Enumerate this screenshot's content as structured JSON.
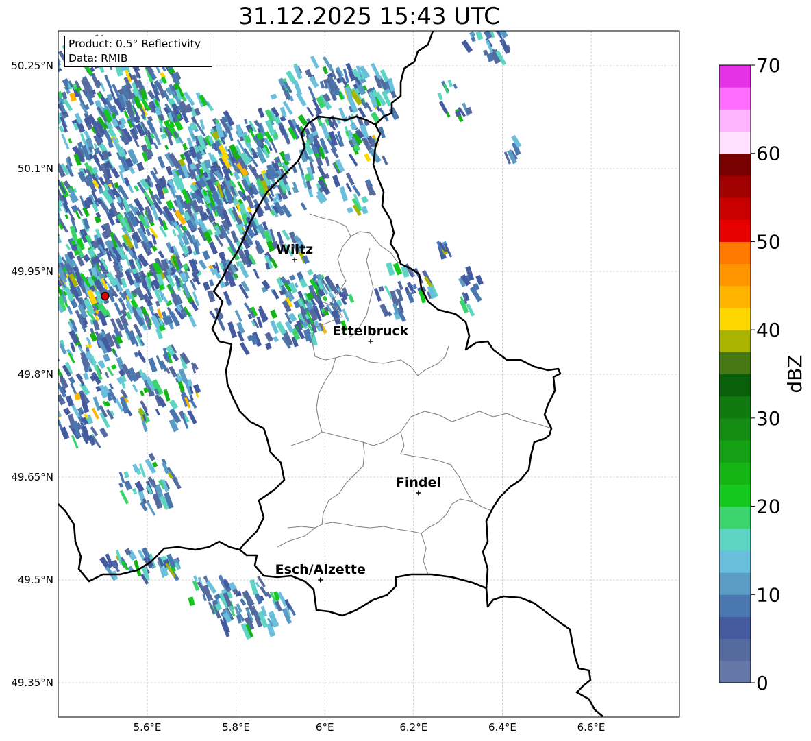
{
  "title": "31.12.2025 15:43 UTC",
  "info": {
    "product": "Product: 0.5° Reflectivity",
    "data_source": "Data: RMIB"
  },
  "lat_ticks": [
    {
      "label": "50.25°N",
      "value": 50.25
    },
    {
      "label": "50.1°N",
      "value": 50.1
    },
    {
      "label": "49.95°N",
      "value": 49.95
    },
    {
      "label": "49.8°N",
      "value": 49.8
    },
    {
      "label": "49.65°N",
      "value": 49.65
    },
    {
      "label": "49.5°N",
      "value": 49.5
    },
    {
      "label": "49.35°N",
      "value": 49.35
    }
  ],
  "lon_ticks": [
    {
      "label": "5.6°E",
      "value": 5.6
    },
    {
      "label": "5.8°E",
      "value": 5.8
    },
    {
      "label": "6°E",
      "value": 6.0
    },
    {
      "label": "6.2°E",
      "value": 6.2
    },
    {
      "label": "6.4°E",
      "value": 6.4
    },
    {
      "label": "6.6°E",
      "value": 6.6
    }
  ],
  "cities": [
    {
      "name": "Wiltz",
      "lon": 5.932,
      "lat": 49.967
    },
    {
      "name": "Ettelbruck",
      "lon": 6.103,
      "lat": 49.848
    },
    {
      "name": "Findel",
      "lon": 6.211,
      "lat": 49.627
    },
    {
      "name": "Esch/Alzette",
      "lon": 5.99,
      "lat": 49.5
    }
  ],
  "radar_site": {
    "lon": 5.505,
    "lat": 49.914
  },
  "colorbar": {
    "unit": "dBZ",
    "min": 0,
    "max": 70,
    "tick_labels": [
      "0",
      "10",
      "20",
      "30",
      "40",
      "50",
      "60",
      "70"
    ],
    "colors": [
      "#6577a6",
      "#556a9e",
      "#445ba0",
      "#4a77b0",
      "#5a9cc4",
      "#6ac0dc",
      "#5ed4c4",
      "#3cd46c",
      "#14c81e",
      "#14b414",
      "#14a014",
      "#148c14",
      "#0f780f",
      "#0a5f0a",
      "#467814",
      "#aab400",
      "#ffd700",
      "#ffb400",
      "#ff9600",
      "#ff7800",
      "#e60000",
      "#c80000",
      "#a00000",
      "#780000",
      "#ffe1ff",
      "#ffb4ff",
      "#ff6eff",
      "#e632e6"
    ]
  }
}
